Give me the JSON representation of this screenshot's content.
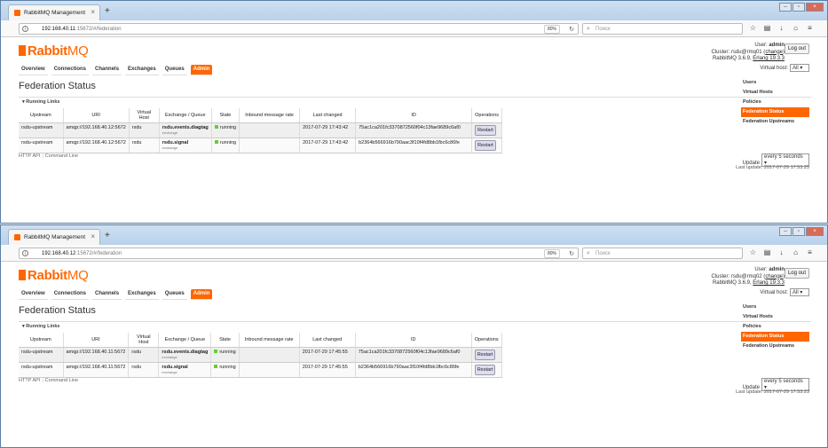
{
  "windows": [
    {
      "tab_title": "RabbitMQ Management",
      "url_host": "192.168.40.11",
      "url_rest": ":15672/#/federation",
      "zoom": "80%",
      "search_placeholder": "Поиск",
      "user_label": "User:",
      "user": "admin",
      "cluster_label": "Cluster:",
      "cluster": "rsdu@rmq01",
      "change_label": "change",
      "version": "RabbitMQ 3.6.9,",
      "erlang": "Erlang 19.3.3",
      "logout": "Log out",
      "vhost_label": "Virtual host:",
      "vhost_value": "All",
      "rows": [
        {
          "upstream": "rsdu-upstream",
          "uri": "amqp://192.168.40.12:5672",
          "vhost": "rsdu",
          "name": "rsdu.events.diagtag",
          "kind": "exchange",
          "state": "running",
          "rate": "",
          "changed": "2017-07-29 17:43:42",
          "id": "75ac1ca201fc3370872560f04c13fae9689c6af0",
          "op": "Restart"
        },
        {
          "upstream": "rsdu-upstream",
          "uri": "amqp://192.168.40.12:5672",
          "vhost": "rsdu",
          "name": "rsdu.signal",
          "kind": "exchange",
          "state": "running",
          "rate": "",
          "changed": "2017-07-29 17:43:42",
          "id": "b2364b566916b790aac3f10f4fd8bb1fbc6c86fe",
          "op": "Restart"
        }
      ],
      "last_update": "Last update: 2017-07-29 17:53:25"
    },
    {
      "tab_title": "RabbitMQ Management",
      "url_host": "192.168.40.12",
      "url_rest": ":15672/#/federation",
      "zoom": "80%",
      "search_placeholder": "Поиск",
      "user_label": "User:",
      "user": "admin",
      "cluster_label": "Cluster:",
      "cluster": "rsdu@rmq02",
      "change_label": "change",
      "version": "RabbitMQ 3.6.9,",
      "erlang": "Erlang 19.3.3",
      "logout": "Log out",
      "vhost_label": "Virtual host:",
      "vhost_value": "All",
      "rows": [
        {
          "upstream": "rsdu-upstream",
          "uri": "amqp://192.168.40.11:5672",
          "vhost": "rsdu",
          "name": "rsdu.events.diagtag",
          "kind": "exchange",
          "state": "running",
          "rate": "",
          "changed": "2017-07-29 17:45:55",
          "id": "75ac1ca201fc3370872560f04c13fae9689c6af0",
          "op": "Restart"
        },
        {
          "upstream": "rsdu-upstream",
          "uri": "amqp://192.168.40.11:5672",
          "vhost": "rsdu",
          "name": "rsdu.signal",
          "kind": "exchange",
          "state": "running",
          "rate": "",
          "changed": "2017-07-29 17:45:55",
          "id": "b2364b566916b790aac3f10f4fd8bb1fbc6c86fe",
          "op": "Restart"
        }
      ],
      "last_update": "Last update: 2017-07-29 17:53:23"
    }
  ],
  "common": {
    "logo_bold": "Rabbit",
    "logo_light": "MQ",
    "tabs": [
      "Overview",
      "Connections",
      "Channels",
      "Exchanges",
      "Queues",
      "Admin"
    ],
    "active_tab": "Admin",
    "page_title": "Federation Status",
    "section_title": "Running Links",
    "columns": [
      "Upstream",
      "URI",
      "Virtual Host",
      "Exchange / Queue",
      "State",
      "Inbound message rate",
      "Last changed",
      "ID",
      "Operations"
    ],
    "footer_links": [
      "HTTP API",
      "Command Line"
    ],
    "update_label": "Update",
    "update_value": "every 5 seconds",
    "side_menu": [
      "Users",
      "Virtual Hosts",
      "Policies",
      "Federation Status",
      "Federation Upstreams"
    ],
    "side_active": "Federation Status"
  }
}
